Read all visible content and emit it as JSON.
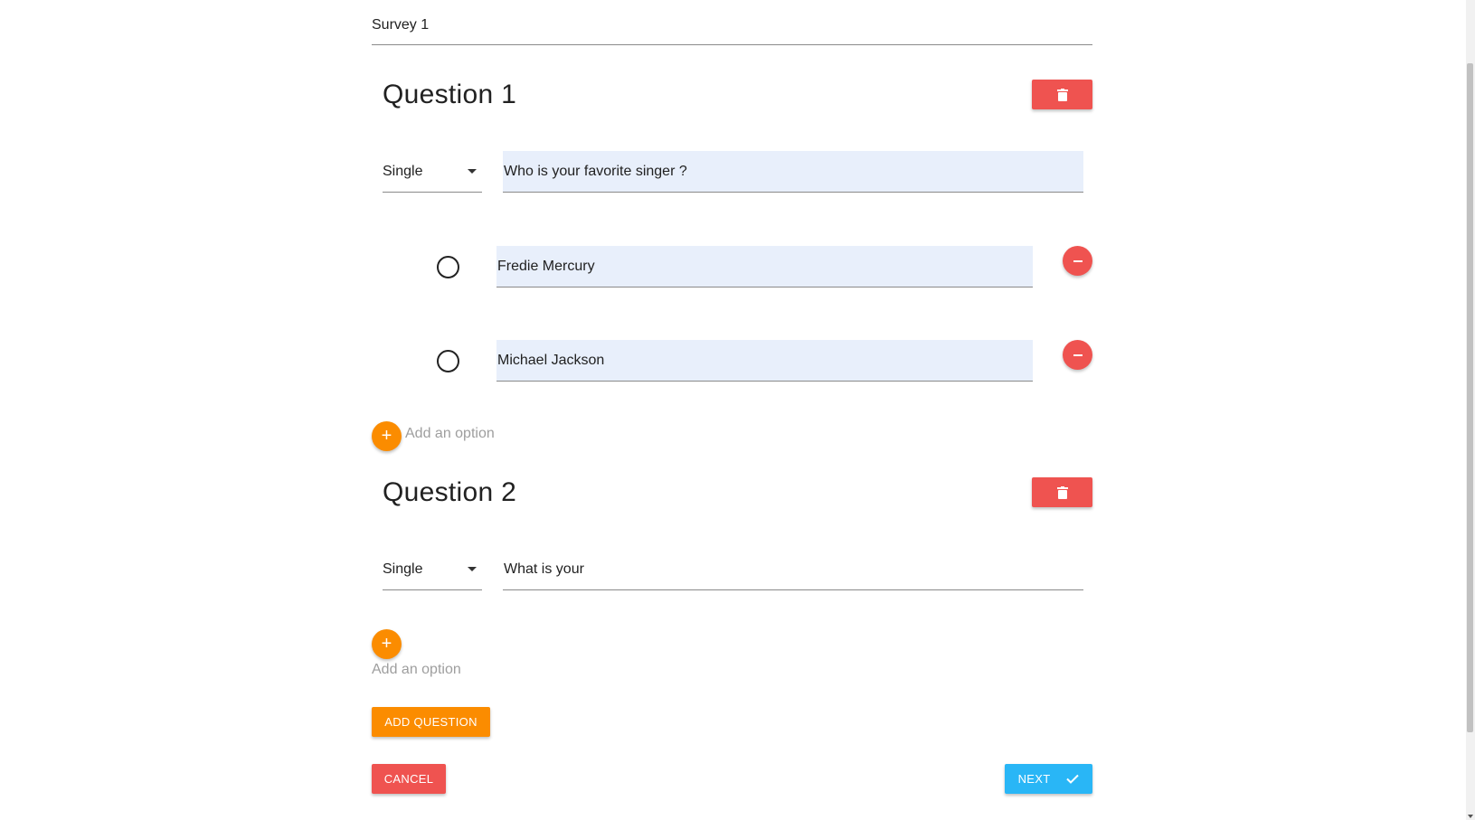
{
  "survey": {
    "title": "Survey 1"
  },
  "questions": [
    {
      "heading": "Question 1",
      "type": "Single",
      "text": "Who is your favorite singer ?",
      "options": [
        "Fredie Mercury",
        "Michael Jackson"
      ],
      "add_option_label": "Add an option"
    },
    {
      "heading": "Question 2",
      "type": "Single",
      "text": "What is your",
      "options": [],
      "add_option_label": "Add an option"
    }
  ],
  "actions": {
    "add_question": "ADD QUESTION",
    "cancel": "CANCEL",
    "next": "NEXT"
  },
  "icons": {
    "delete": "trash-icon",
    "remove": "minus-icon",
    "add": "plus-icon",
    "next": "check-icon",
    "select": "caret-down-icon"
  },
  "colors": {
    "danger": "#ef5350",
    "warning": "#fb8c00",
    "primary": "#29b6f6",
    "field_fill": "#e8effb"
  }
}
